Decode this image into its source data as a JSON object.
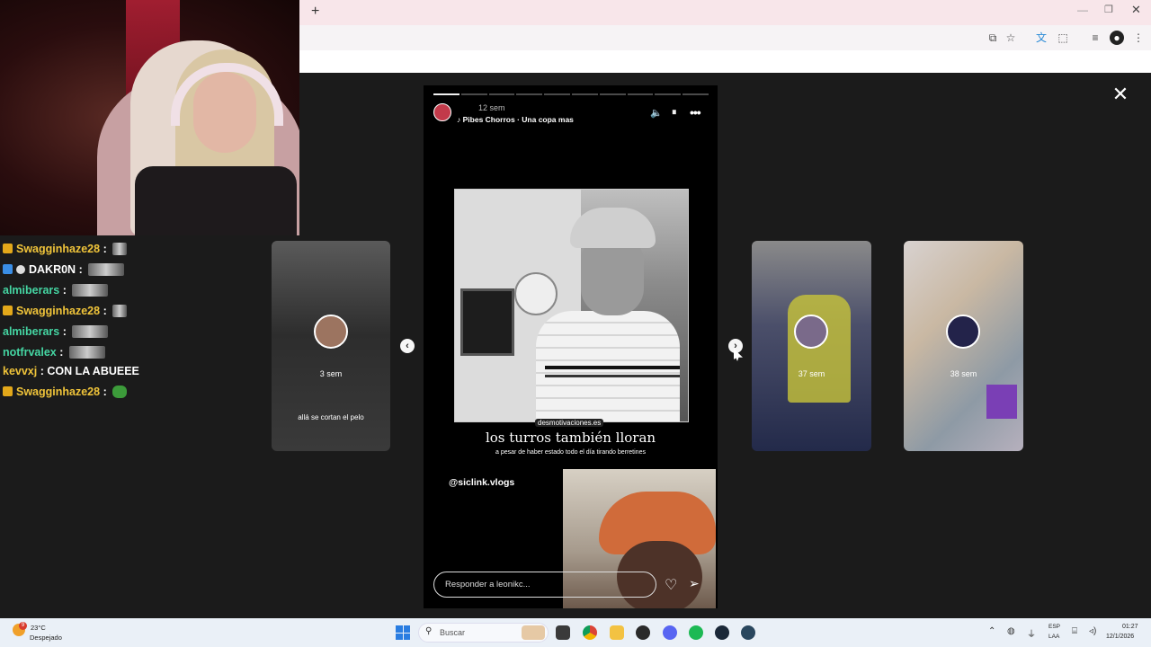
{
  "browser": {
    "new_tab": "+",
    "minimize": "—",
    "maximize": "❐",
    "close": "✕"
  },
  "viewer": {
    "close": "✕"
  },
  "chat": [
    {
      "user": "Swagginhaze28",
      "user_color": "#f0c43a",
      "sep": " : ",
      "badge": "gold",
      "message": ""
    },
    {
      "user": "DAKR0N",
      "user_color": "#ffffff",
      "sep": " : ",
      "badge": "blue",
      "message": ""
    },
    {
      "user": "almiberars",
      "user_color": "#45d6a3",
      "sep": " : ",
      "badge": "",
      "message": ""
    },
    {
      "user": "Swagginhaze28",
      "user_color": "#f0c43a",
      "sep": " : ",
      "badge": "gold",
      "message": ""
    },
    {
      "user": "almiberars",
      "user_color": "#45d6a3",
      "sep": " : ",
      "badge": "",
      "message": ""
    },
    {
      "user": "notfrvalex",
      "user_color": "#45d6a3",
      "sep": " : ",
      "badge": "",
      "message": ""
    },
    {
      "user": "kevvxj",
      "user_color": "#f0c43a",
      "sep": " : ",
      "badge": "",
      "message": "CON LA ABUEEE"
    },
    {
      "user": "Swagginhaze28",
      "user_color": "#f0c43a",
      "sep": " : ",
      "badge": "gold",
      "message": ""
    }
  ],
  "stories": {
    "left": {
      "age": "3 sem",
      "caption": "allá se cortan el pelo"
    },
    "right1": {
      "age": "37 sem"
    },
    "right2": {
      "age": "38 sem"
    }
  },
  "main_story": {
    "time": "12 sem",
    "music": "Pibes Chorros · Una copa mas",
    "watermark": "desmotivaciones.es",
    "title": "los turros también lloran",
    "subtitle": "a pesar de haber estado todo el día tirando berretines",
    "handle": "@siclink.vlogs",
    "reply_placeholder": "Responder a leonikc...",
    "progress_segments": 10,
    "progress_done": 1
  },
  "icons": {
    "mute": "🔈",
    "pause": "⏸",
    "more": "•••",
    "like": "♡",
    "share": "➢",
    "prev": "‹",
    "next": "›"
  },
  "taskbar": {
    "temperature": "23°C",
    "condition": "Despejado",
    "weather_badge": "9",
    "search": "Buscar",
    "lang_line1": "ESP",
    "lang_line2": "LAA",
    "time": "01:27",
    "date": "12/1/2026"
  },
  "colors": {
    "accent_blue": "#2a7de1",
    "chat_gold": "#f0c43a",
    "chat_green": "#45d6a3"
  }
}
